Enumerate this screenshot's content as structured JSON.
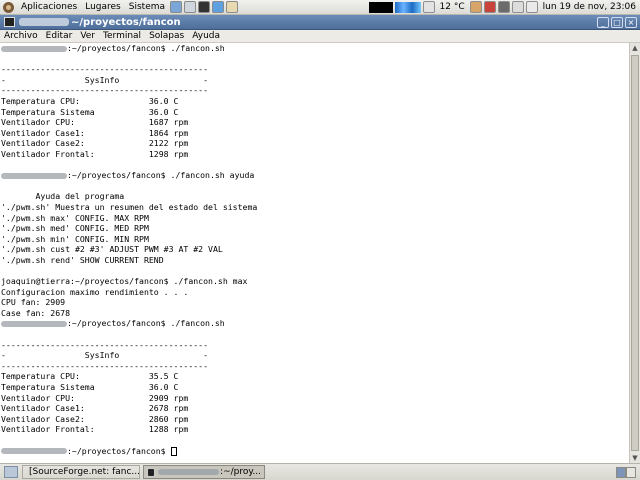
{
  "top_panel": {
    "menus": [
      "Aplicaciones",
      "Lugares",
      "Sistema"
    ],
    "weather": "12 °C",
    "clock": "lun 19 de nov, 23:06"
  },
  "window": {
    "title": "~/proyectos/fancon"
  },
  "menubar": [
    "Archivo",
    "Editar",
    "Ver",
    "Terminal",
    "Solapas",
    "Ayuda"
  ],
  "terminal": {
    "lines": [
      {
        "t": "prompt",
        "text": ":~/proyectos/fancon$ ./fancon.sh"
      },
      {
        "t": "blank"
      },
      {
        "t": "text",
        "text": "------------------------------------------"
      },
      {
        "t": "text",
        "text": "-                SysInfo                 -"
      },
      {
        "t": "text",
        "text": "------------------------------------------"
      },
      {
        "t": "text",
        "text": "Temperatura CPU:              36.0 C"
      },
      {
        "t": "text",
        "text": "Temperatura Sistema           36.0 C"
      },
      {
        "t": "text",
        "text": "Ventilador CPU:               1687 rpm"
      },
      {
        "t": "text",
        "text": "Ventilador Case1:             1864 rpm"
      },
      {
        "t": "text",
        "text": "Ventilador Case2:             2122 rpm"
      },
      {
        "t": "text",
        "text": "Ventilador Frontal:           1298 rpm"
      },
      {
        "t": "blank"
      },
      {
        "t": "prompt",
        "text": ":~/proyectos/fancon$ ./fancon.sh ayuda"
      },
      {
        "t": "blank"
      },
      {
        "t": "text",
        "text": "       Ayuda del programa"
      },
      {
        "t": "text",
        "text": "'./pwm.sh' Muestra un resumen del estado del sistema"
      },
      {
        "t": "text",
        "text": "'./pwm.sh max' CONFIG. MAX RPM"
      },
      {
        "t": "text",
        "text": "'./pwm.sh med' CONFIG. MED RPM"
      },
      {
        "t": "text",
        "text": "'./pwm.sh min' CONFIG. MIN RPM"
      },
      {
        "t": "text",
        "text": "'./pwm.sh cust #2 #3' ADJUST PWM #3 AT #2 VAL"
      },
      {
        "t": "text",
        "text": "'./pwm.sh rend' SHOW CURRENT REND"
      },
      {
        "t": "blank"
      },
      {
        "t": "text",
        "text": "joaquin@tierra:~/proyectos/fancon$ ./fancon.sh max"
      },
      {
        "t": "text",
        "text": "Configuracion maximo rendimiento . . ."
      },
      {
        "t": "text",
        "text": "CPU fan: 2909"
      },
      {
        "t": "text",
        "text": "Case fan: 2678"
      },
      {
        "t": "prompt",
        "text": ":~/proyectos/fancon$ ./fancon.sh"
      },
      {
        "t": "blank"
      },
      {
        "t": "text",
        "text": "------------------------------------------"
      },
      {
        "t": "text",
        "text": "-                SysInfo                 -"
      },
      {
        "t": "text",
        "text": "------------------------------------------"
      },
      {
        "t": "text",
        "text": "Temperatura CPU:              35.5 C"
      },
      {
        "t": "text",
        "text": "Temperatura Sistema           36.0 C"
      },
      {
        "t": "text",
        "text": "Ventilador CPU:               2909 rpm"
      },
      {
        "t": "text",
        "text": "Ventilador Case1:             2678 rpm"
      },
      {
        "t": "text",
        "text": "Ventilador Case2:             2860 rpm"
      },
      {
        "t": "text",
        "text": "Ventilador Frontal:           1288 rpm"
      },
      {
        "t": "blank"
      },
      {
        "t": "prompt-cursor",
        "text": ":~/proyectos/fancon$ "
      }
    ]
  },
  "taskbar": {
    "tasks": [
      {
        "label": "[SourceForge.net: fanc...",
        "active": false
      },
      {
        "label": ":~/proy...",
        "active": true
      }
    ]
  }
}
